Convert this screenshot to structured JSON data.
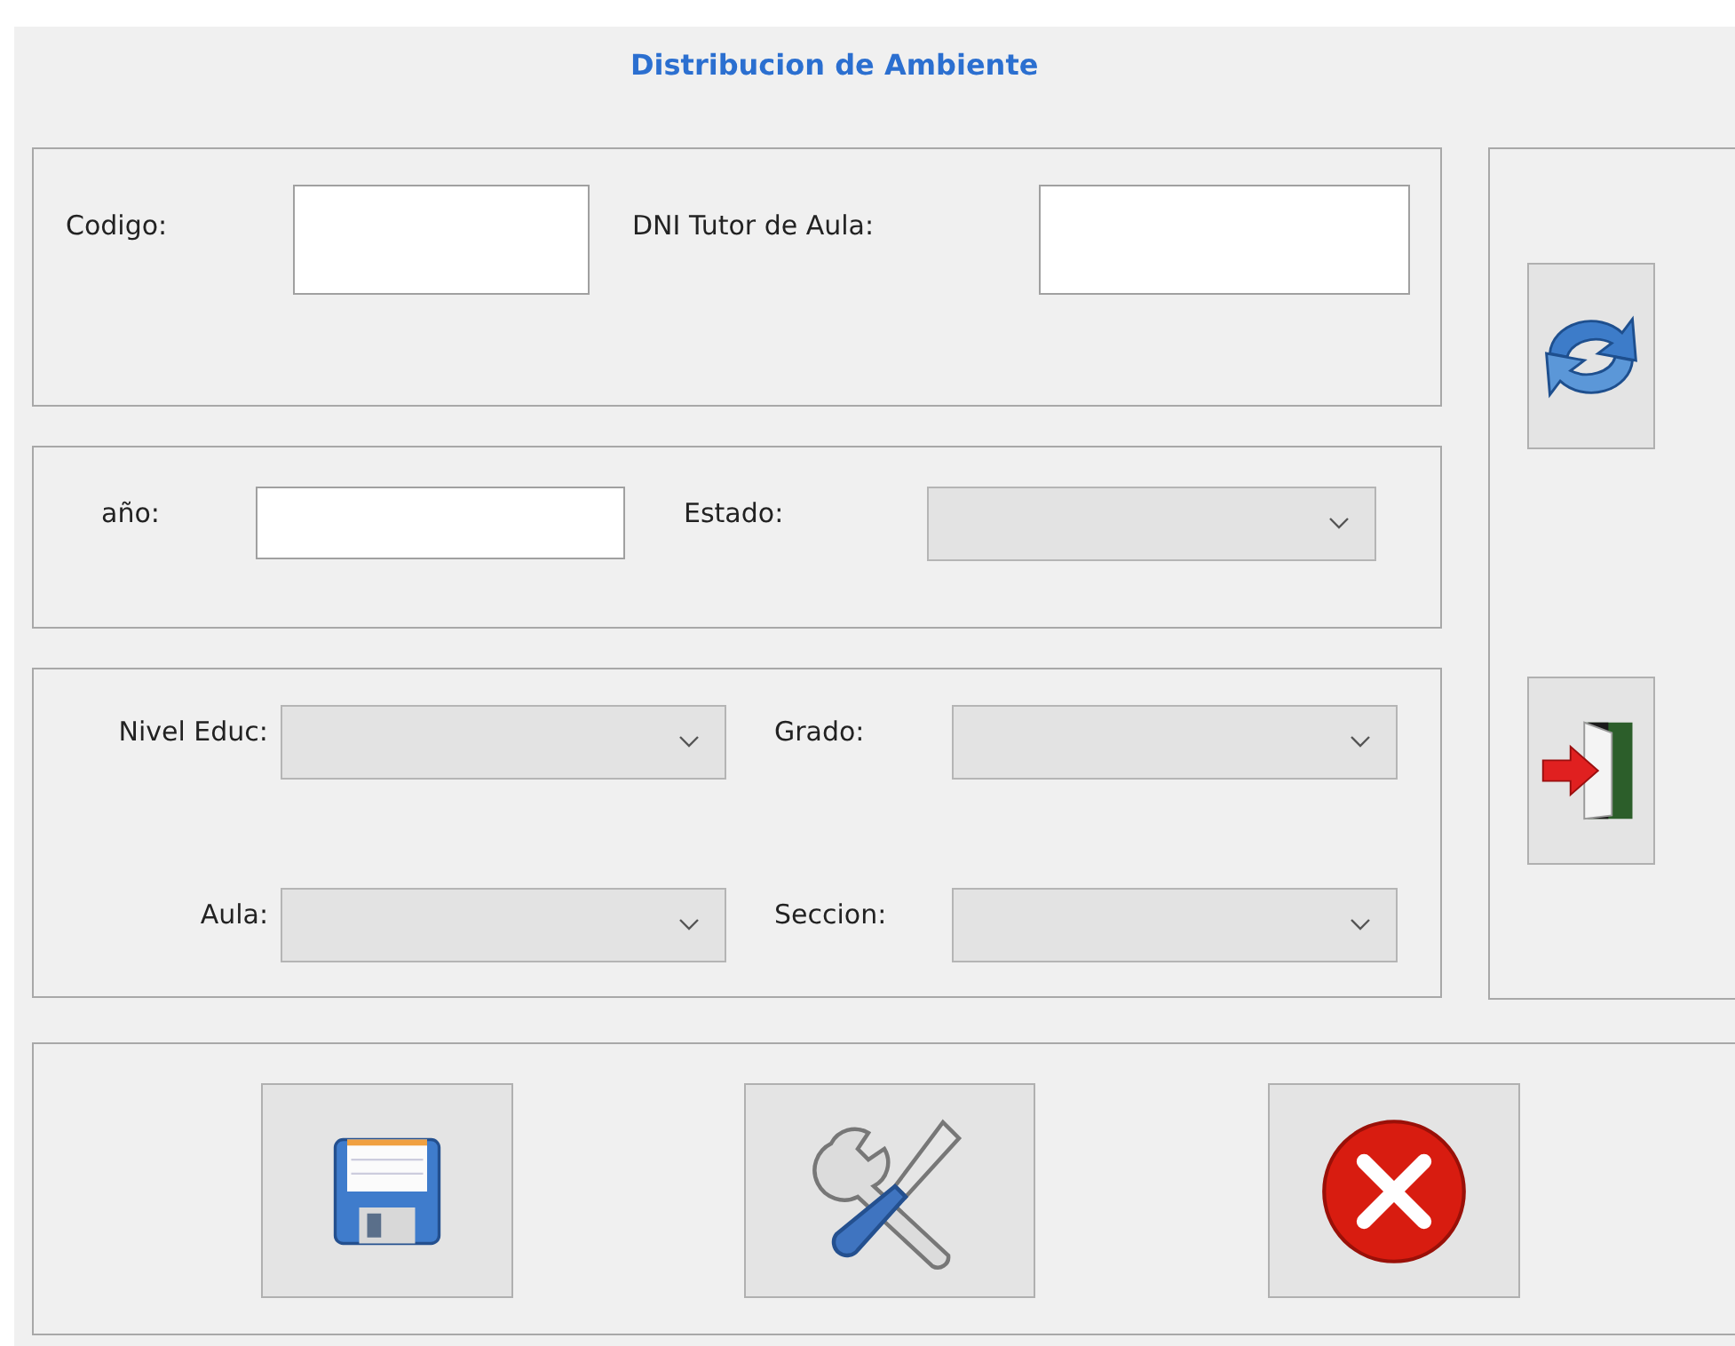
{
  "title": "Distribucion de Ambiente",
  "panels": [
    {
      "fields": [
        {
          "label": "Codigo:",
          "kind": "text",
          "disabled": false
        },
        {
          "label": "DNI Tutor de Aula:",
          "kind": "text",
          "disabled": false
        }
      ]
    },
    {
      "fields": [
        {
          "label": "año:",
          "kind": "text",
          "disabled": false
        },
        {
          "label": "Estado:",
          "kind": "combo",
          "disabled": true
        }
      ]
    },
    {
      "fields": [
        {
          "label": "Nivel Educ:",
          "kind": "combo",
          "disabled": true
        },
        {
          "label": "Grado:",
          "kind": "combo",
          "disabled": true
        },
        {
          "label": "Aula:",
          "kind": "combo",
          "disabled": true
        },
        {
          "label": "Seccion:",
          "kind": "combo",
          "disabled": true
        }
      ]
    }
  ],
  "side_buttons": [
    {
      "kind": "refresh"
    },
    {
      "kind": "exit"
    }
  ],
  "bottom_buttons": [
    {
      "kind": "save"
    },
    {
      "kind": "tools"
    },
    {
      "kind": "cancel"
    }
  ]
}
